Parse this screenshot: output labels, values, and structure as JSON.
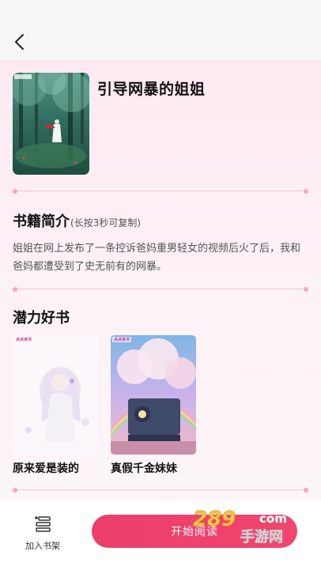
{
  "book": {
    "title": "引导网暴的姐姐"
  },
  "intro_section": {
    "title": "书籍简介",
    "hint": "(长按3秒可复制)",
    "text": "姐姐在网上发布了一条控诉爸妈重男轻女的视频后火了后，我和爸妈都遭受到了史无前有的网暴。"
  },
  "recommend_section": {
    "title": "潜力好书",
    "books": [
      {
        "name": "原来爱是装的",
        "logo": "点点读书"
      },
      {
        "name": "真假千金妹妹",
        "logo": "点点读书"
      }
    ]
  },
  "bottom_bar": {
    "shelf_label": "加入书架",
    "read_label": "开始阅读"
  },
  "watermark": {
    "brand_number": "289",
    "domain": "com",
    "site_name": "手游网"
  },
  "icons": {
    "back": "back-arrow-icon",
    "shelf": "bookshelf-icon"
  },
  "colors": {
    "accent": "#ee4069",
    "page_tint": "#fde9f1",
    "divider_dot": "#f2a9c2"
  }
}
